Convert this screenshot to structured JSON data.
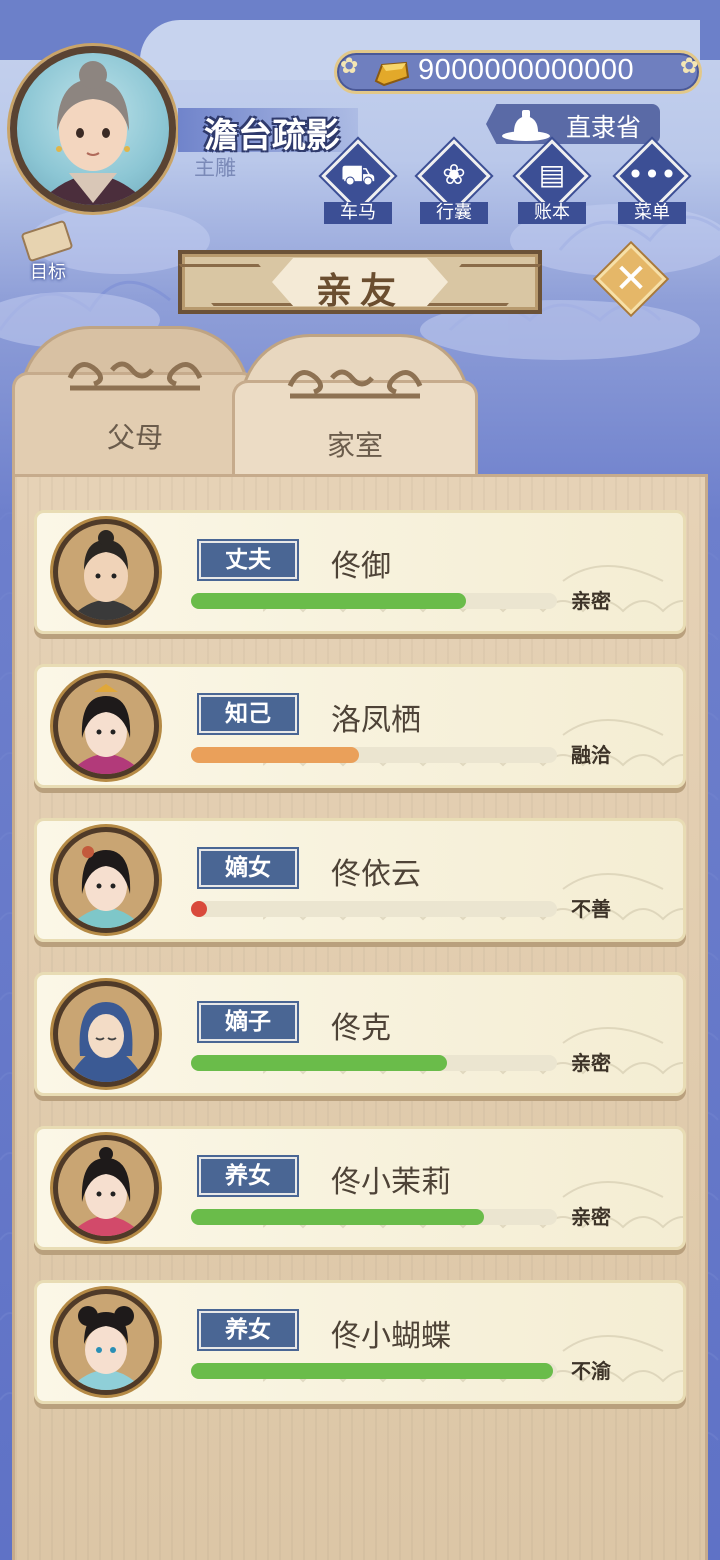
{
  "player": {
    "name": "澹台疏影",
    "title": "主雕"
  },
  "currency": {
    "value": "9000000000000",
    "icon": "gold-ingot-icon"
  },
  "province": {
    "label": "直隶省",
    "icon": "seal-stamp-icon"
  },
  "top_menu": [
    {
      "label": "车马",
      "icon": "carriage-icon"
    },
    {
      "label": "行囊",
      "icon": "bundle-icon"
    },
    {
      "label": "账本",
      "icon": "ledger-icon"
    },
    {
      "label": "菜单",
      "icon": "more-icon"
    }
  ],
  "goal": {
    "label": "目标",
    "icon": "scroll-icon"
  },
  "title": "亲友",
  "tabs": [
    {
      "label": "父母",
      "active": false
    },
    {
      "label": "家室",
      "active": true
    }
  ],
  "relatives": [
    {
      "role": "丈夫",
      "name": "佟御",
      "status": "亲密",
      "level": 0.75,
      "bar_color": "#6abc4a"
    },
    {
      "role": "知己",
      "name": "洛凤栖",
      "status": "融洽",
      "level": 0.46,
      "bar_color": "#eaa05a"
    },
    {
      "role": "嫡女",
      "name": "佟依云",
      "status": "不善",
      "level": 0.03,
      "bar_color": "#d94a3c"
    },
    {
      "role": "嫡子",
      "name": "佟克",
      "status": "亲密",
      "level": 0.7,
      "bar_color": "#6abc4a"
    },
    {
      "role": "养女",
      "name": "佟小茉莉",
      "status": "亲密",
      "level": 0.8,
      "bar_color": "#6abc4a"
    },
    {
      "role": "养女",
      "name": "佟小蝴蝶",
      "status": "不渝",
      "level": 0.99,
      "bar_color": "#6abc4a"
    }
  ],
  "colors": {
    "accent_blue": "#3c4f95",
    "tag_blue": "#4a6694",
    "wood": "#e2cdb1"
  }
}
